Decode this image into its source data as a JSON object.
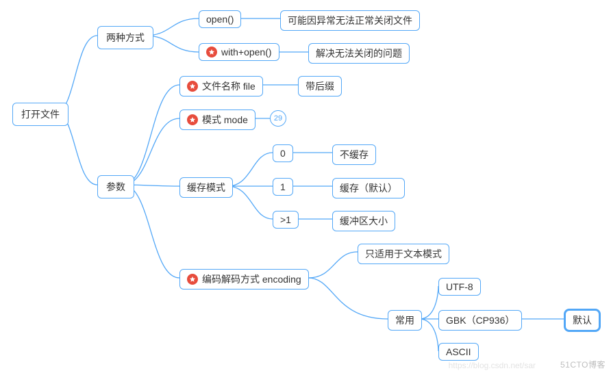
{
  "chart_data": {
    "type": "tree",
    "root": {
      "label": "打开文件",
      "children": [
        {
          "label": "两种方式",
          "children": [
            {
              "label": "open()",
              "children": [
                {
                  "label": "可能因异常无法正常关闭文件"
                }
              ]
            },
            {
              "label": "with+open()",
              "starred": true,
              "children": [
                {
                  "label": "解决无法关闭的问题"
                }
              ]
            }
          ]
        },
        {
          "label": "参数",
          "children": [
            {
              "label": "文件名称 file",
              "starred": true,
              "children": [
                {
                  "label": "带后缀"
                }
              ]
            },
            {
              "label": "模式 mode",
              "starred": true,
              "badge": 29
            },
            {
              "label": "缓存模式",
              "children": [
                {
                  "label": "0",
                  "children": [
                    {
                      "label": "不缓存"
                    }
                  ]
                },
                {
                  "label": "1",
                  "children": [
                    {
                      "label": "缓存（默认）"
                    }
                  ]
                },
                {
                  "label": ">1",
                  "children": [
                    {
                      "label": "缓冲区大小"
                    }
                  ]
                }
              ]
            },
            {
              "label": "编码解码方式 encoding",
              "starred": true,
              "children": [
                {
                  "label": "只适用于文本模式"
                },
                {
                  "label": "常用",
                  "children": [
                    {
                      "label": "UTF-8"
                    },
                    {
                      "label": "GBK（CP936）",
                      "children": [
                        {
                          "label": "默认",
                          "highlight": true
                        }
                      ]
                    },
                    {
                      "label": "ASCII"
                    }
                  ]
                }
              ]
            }
          ]
        }
      ]
    }
  },
  "nodes": {
    "root": "打开文件",
    "ways": "两种方式",
    "open": "open()",
    "open_note": "可能因异常无法正常关闭文件",
    "withopen": "with+open()",
    "withopen_note": "解决无法关闭的问题",
    "params": "参数",
    "filename": "文件名称 file",
    "filename_note": "带后缀",
    "mode": "模式 mode",
    "mode_badge": "29",
    "buffer": "缓存模式",
    "b0": "0",
    "b0_note": "不缓存",
    "b1": "1",
    "b1_note": "缓存（默认）",
    "bgt1": ">1",
    "bgt1_note": "缓冲区大小",
    "encoding": "编码解码方式 encoding",
    "enc_text": "只适用于文本模式",
    "enc_common": "常用",
    "enc_utf8": "UTF-8",
    "enc_gbk": "GBK（CP936）",
    "enc_ascii": "ASCII",
    "enc_default": "默认"
  },
  "watermark": "51CTO博客",
  "watermark2": "https://blog.csdn.net/sar"
}
